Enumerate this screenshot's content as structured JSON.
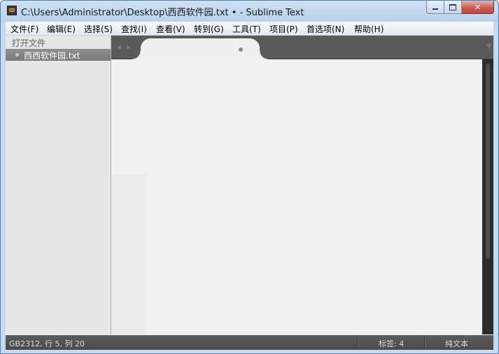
{
  "window": {
    "title": "C:\\Users\\Administrator\\Desktop\\西西软件园.txt • - Sublime Text",
    "close_label": "✕"
  },
  "menu": [
    {
      "label": "文件(F)"
    },
    {
      "label": "编辑(E)"
    },
    {
      "label": "选择(S)"
    },
    {
      "label": "查找(I)"
    },
    {
      "label": "查看(V)"
    },
    {
      "label": "转到(G)"
    },
    {
      "label": "工具(T)"
    },
    {
      "label": "项目(P)"
    },
    {
      "label": "首选项(N)"
    },
    {
      "label": "帮助(H)"
    }
  ],
  "sidebar": {
    "header": "打开文件",
    "files": [
      {
        "name": "西西软件园.txt",
        "modified": true
      }
    ]
  },
  "tabs": [
    {
      "title": "",
      "modified": true,
      "active": true
    }
  ],
  "statusbar": {
    "position": "GB2312, 行 5, 列 20",
    "tab_size": "标签: 4",
    "syntax": "纯文本"
  },
  "colors": {
    "title_bar": "#c6d9ee",
    "menu_bar": "#e4e9f1",
    "sidebar": "#e6e6e6",
    "sidebar_selected": "#808080",
    "tab_bar": "#5a5a5a",
    "editor": "#f1f1f1",
    "status_bar": "#4f4f4f",
    "close_button": "#c9574a"
  }
}
